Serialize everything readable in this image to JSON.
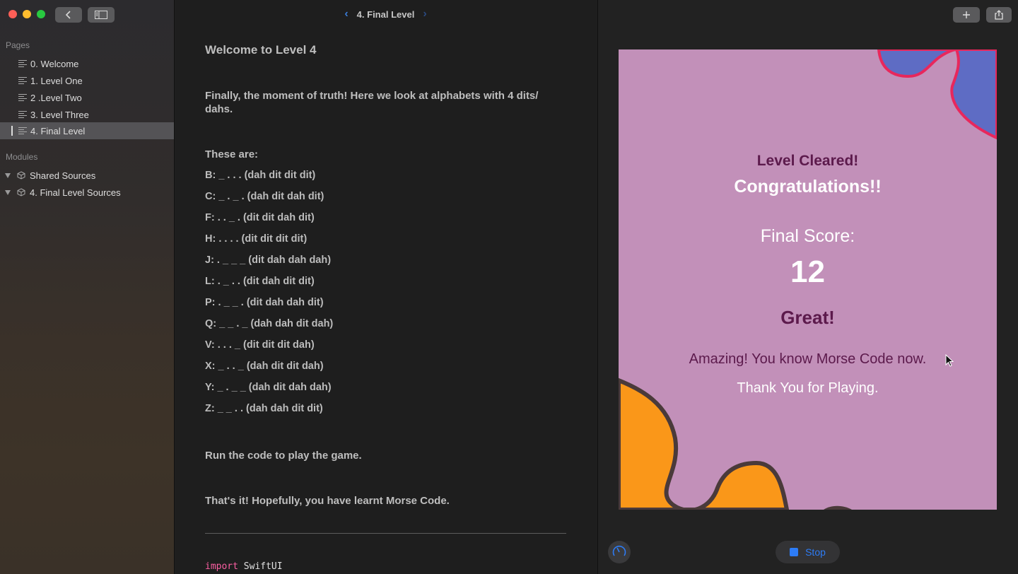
{
  "window": {
    "title": "4. Final Level"
  },
  "sidebar": {
    "pages_header": "Pages",
    "pages": [
      {
        "label": "0. Welcome"
      },
      {
        "label": "1. Level One"
      },
      {
        "label": "2 .Level Two"
      },
      {
        "label": "3. Level Three"
      },
      {
        "label": "4. Final Level",
        "selected": true
      }
    ],
    "modules_header": "Modules",
    "modules": [
      {
        "label": "Shared Sources"
      },
      {
        "label": "4. Final Level Sources"
      }
    ]
  },
  "doc": {
    "heading": "Welcome to Level 4",
    "intro_line1": "Finally, the moment of truth! Here we look at alphabets with 4 dits/",
    "intro_line2": "dahs.",
    "these_are": "These are:",
    "codes": [
      "B:  _ . . .  (dah dit dit dit)",
      "C:  _ . _ .  (dah dit dah dit)",
      "F:  . . _ .  (dit dit dah dit)",
      "H:  . . . .  (dit dit dit dit)",
      "J:  . _ _ _  (dit dah dah dah)",
      "L:  . _ . .  (dit dah dit dit)",
      "P:  . _ _ .  (dit dah dah dit)",
      "Q:  _ _ . _  (dah dah dit dah)",
      "V:  . . . _  (dit dit dit dah)",
      "X:  _ . . _  (dah dit dit dah)",
      "Y:  _ . _ _  (dah dit dah dah)",
      "Z:  _ _ . .  (dah dah dit dit)"
    ],
    "run_line": "Run the code to play the game.",
    "end_line": "That's it! Hopefully, you have learnt Morse Code.",
    "code_keyword": "import",
    "code_module": "SwiftUI"
  },
  "live_view": {
    "level_cleared": "Level Cleared!",
    "congrats": "Congratulations!!",
    "final_score_label": "Final Score:",
    "final_score_value": "12",
    "rating": "Great!",
    "message": "Amazing! You know Morse Code now.",
    "thanks": "Thank You for Playing.",
    "stop_label": "Stop"
  },
  "colors": {
    "card_background": "#c290b9",
    "accent_dark": "#5c1a4c",
    "blob_blue": "#5e6cc4",
    "blob_orange": "#fa9719",
    "stop_blue": "#2d7cf6"
  },
  "icons": [
    "back-icon",
    "sidebar-toggle-icon",
    "page-icon",
    "module-cube-icon",
    "add-icon",
    "share-icon",
    "gauge-icon",
    "stop-icon",
    "cursor-icon"
  ]
}
